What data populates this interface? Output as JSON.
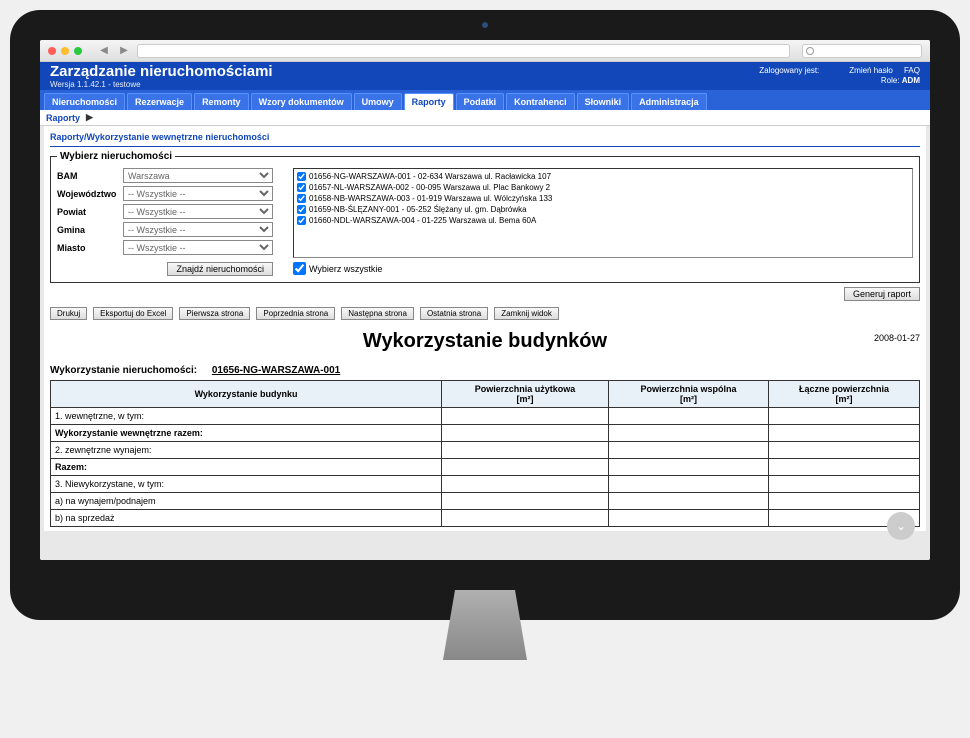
{
  "app": {
    "title": "Zarządzanie nieruchomościami",
    "version": "Wersja 1.1.42.1 - testowe"
  },
  "header": {
    "logged_label": "Zalogowany jest:",
    "role_label": "Role:",
    "role_value": "ADM",
    "change_pw": "Zmień hasło",
    "faq": "FAQ"
  },
  "nav": {
    "tabs": [
      "Nieruchomości",
      "Rezerwacje",
      "Remonty",
      "Wzory dokumentów",
      "Umowy",
      "Raporty",
      "Podatki",
      "Kontrahenci",
      "Słowniki",
      "Administracja"
    ],
    "active_index": 5,
    "subtab": "Raporty"
  },
  "breadcrumb": "Raporty/Wykorzystanie wewnętrzne nieruchomości",
  "filter": {
    "legend": "Wybierz nieruchomości",
    "fields": {
      "bam": {
        "label": "BAM",
        "value": "Warszawa"
      },
      "wojewodztwo": {
        "label": "Województwo",
        "value": "-- Wszystkie --"
      },
      "powiat": {
        "label": "Powiat",
        "value": "-- Wszystkie --"
      },
      "gmina": {
        "label": "Gmina",
        "value": "-- Wszystkie --"
      },
      "miasto": {
        "label": "Miasto",
        "value": "-- Wszystkie --"
      }
    },
    "find_button": "Znajdź nieruchomości",
    "select_all": "Wybierz wszystkie"
  },
  "properties": [
    "01656-NG-WARSZAWA-001 - 02-634 Warszawa ul. Racławicka 107",
    "01657-NL-WARSZAWA-002 - 00-095 Warszawa ul. Plac Bankowy 2",
    "01658-NB-WARSZAWA-003 - 01-919 Warszawa ul. Wólczyńska 133",
    "01659-NB-ŚLĘZANY-001 - 05-252 Ślężany ul. gm. Dąbrówka",
    "01660-NDL-WARSZAWA-004 - 01-225 Warszawa ul. Bema 60A"
  ],
  "actions": {
    "generate": "Generuj raport",
    "print": "Drukuj",
    "export": "Eksportuj do Excel",
    "first": "Pierwsza strona",
    "prev": "Poprzednia strona",
    "next": "Następna strona",
    "last": "Ostatnia strona",
    "close": "Zamknij widok"
  },
  "report": {
    "title": "Wykorzystanie budynków",
    "date": "2008-01-27",
    "subtitle_label": "Wykorzystanie nieruchomości:",
    "subtitle_value": "01656-NG-WARSZAWA-001",
    "columns": {
      "desc": "Wykorzystanie budynku",
      "c1": "Powierzchnia użytkowa",
      "c2": "Powierzchnia wspólna",
      "c3": "Łączne powierzchnia",
      "unit": "[m²]"
    },
    "rows": [
      {
        "text": "1. wewnętrzne, w tym:",
        "bold": false
      },
      {
        "text": "Wykorzystanie wewnętrzne razem:",
        "bold": true
      },
      {
        "text": "2. zewnętrzne wynajem:",
        "bold": false
      },
      {
        "text": "Razem:",
        "bold": true
      },
      {
        "text": "3. Niewykorzystane, w tym:",
        "bold": false
      },
      {
        "text": "a) na wynajem/podnajem",
        "bold": false
      },
      {
        "text": "b) na sprzedaż",
        "bold": false
      }
    ]
  }
}
